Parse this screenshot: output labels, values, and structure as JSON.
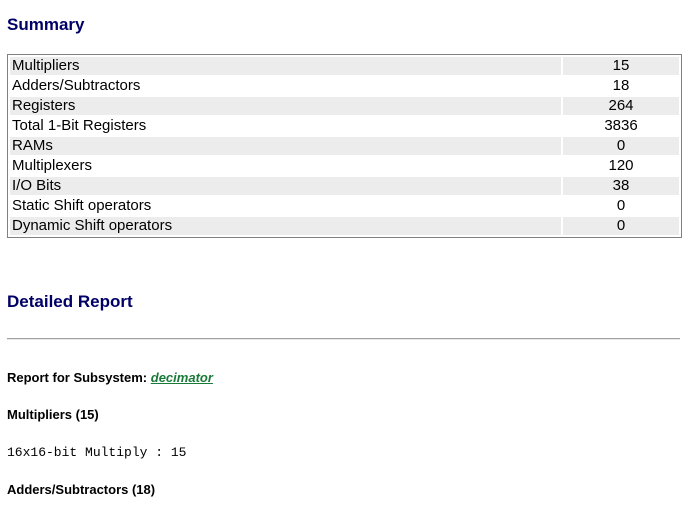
{
  "summary": {
    "title": "Summary",
    "rows": [
      {
        "label": "Multipliers",
        "value": "15"
      },
      {
        "label": "Adders/Subtractors",
        "value": "18"
      },
      {
        "label": "Registers",
        "value": "264"
      },
      {
        "label": "Total 1-Bit Registers",
        "value": "3836"
      },
      {
        "label": "RAMs",
        "value": "0"
      },
      {
        "label": "Multiplexers",
        "value": "120"
      },
      {
        "label": "I/O Bits",
        "value": "38"
      },
      {
        "label": "Static Shift operators",
        "value": "0"
      },
      {
        "label": "Dynamic Shift operators",
        "value": "0"
      }
    ]
  },
  "detailed": {
    "title": "Detailed Report",
    "report_for_label": "Report for Subsystem:",
    "subsystem_link": "decimator",
    "multipliers_heading": "Multipliers (15)",
    "multiply_line": "16x16-bit Multiply : 15",
    "adders_heading": "Adders/Subtractors (18)"
  },
  "colors": {
    "heading": "#000066",
    "link": "#1a7a3a",
    "row_shade": "#ececec"
  }
}
